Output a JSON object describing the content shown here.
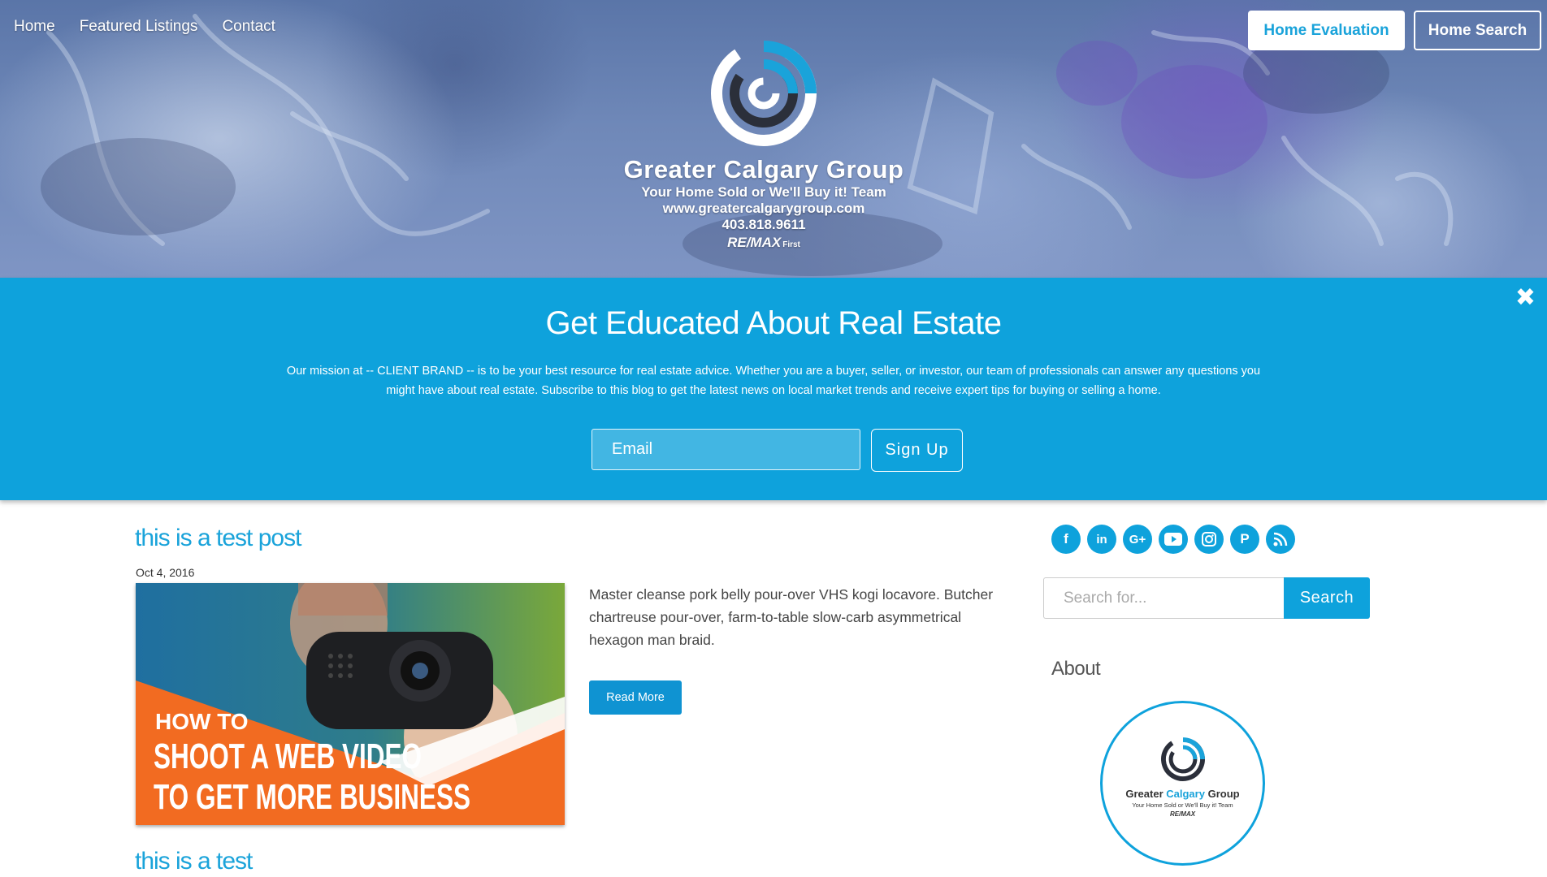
{
  "nav": {
    "items": [
      "Home",
      "Featured Listings",
      "Contact"
    ]
  },
  "header_buttons": {
    "evaluation": "Home Evaluation",
    "search": "Home Search"
  },
  "logo": {
    "title": "Greater Calgary Group",
    "tagline": "Your Home Sold or We'll Buy it! Team",
    "website": "www.greatercalgarygroup.com",
    "phone": "403.818.9611",
    "brokerage": "RE/MAX",
    "brokerage_suffix": "First"
  },
  "banner": {
    "close_icon": "close-icon",
    "title": "Get Educated About Real Estate",
    "text": "Our mission at -- CLIENT BRAND -- is to be your best resource for real estate advice. Whether you are a buyer, seller, or investor, our team of professionals can answer any questions you might have about real estate. Subscribe to this blog to get the latest news on local market trends and receive expert tips for buying or selling a home.",
    "email_placeholder": "Email",
    "signup_label": "Sign Up",
    "color": "#0ea2dc"
  },
  "posts": [
    {
      "title": "this is a test post",
      "date": "Oct 4, 2016",
      "image_text": {
        "line1": "HOW TO",
        "line2": "SHOOT A WEB VIDEO",
        "line3": "TO GET MORE BUSINESS"
      },
      "excerpt": "Master cleanse pork belly pour-over VHS kogi locavore. Butcher chartreuse pour-over, farm-to-table slow-carb asymmetrical hexagon man braid.",
      "read_more": "Read More"
    },
    {
      "title": "this is a test"
    }
  ],
  "sidebar": {
    "social": [
      "facebook-icon",
      "linkedin-icon",
      "google-plus-icon",
      "youtube-icon",
      "instagram-icon",
      "pinterest-icon",
      "rss-icon"
    ],
    "search_placeholder": "Search for...",
    "search_label": "Search",
    "about_title": "About",
    "about_logo": {
      "title_a": "Greater",
      "title_b": "Calgary",
      "title_c": "Group",
      "tagline": "Your Home Sold or We'll Buy it! Team",
      "brokerage": "RE/MAX"
    }
  },
  "colors": {
    "accent": "#0ea2dc",
    "link": "#1aa3da",
    "button": "#0f93d2",
    "image_orange": "#f26b21"
  }
}
